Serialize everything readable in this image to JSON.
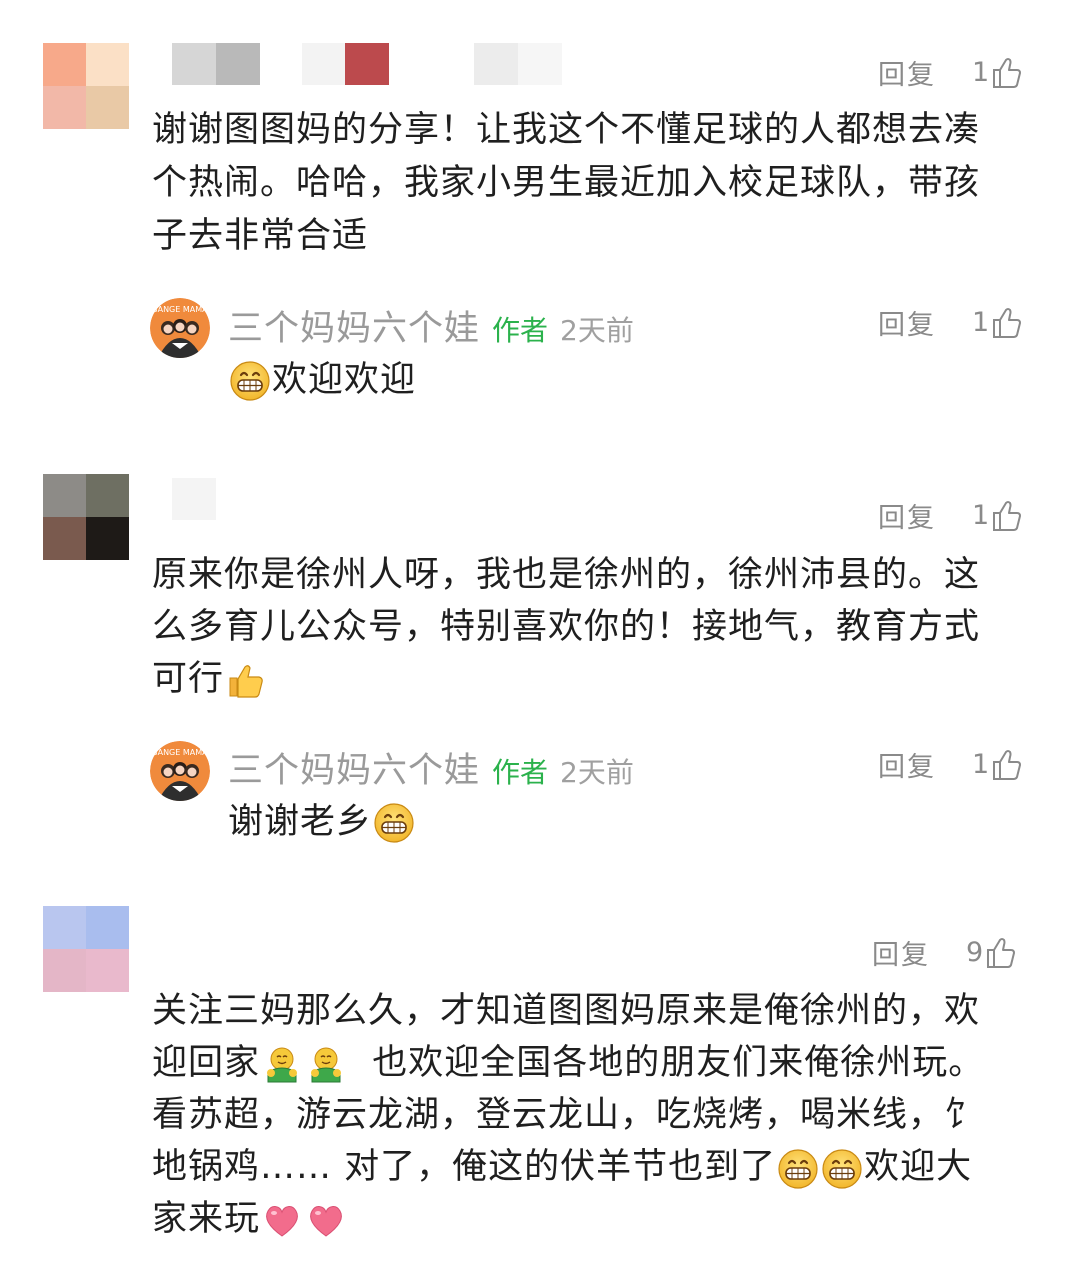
{
  "comments": [
    {
      "avatar_colors": [
        "#f7a98a",
        "#fbe0c6",
        "#f2b8a8",
        "#e9c9a6"
      ],
      "name_blur_colors": [
        "#d6d6d6",
        "#b9b9b9",
        "#bc4a4d",
        "#ececec"
      ],
      "reply_label": "回复",
      "likes": "1",
      "text_lines": [
        "谢谢图图妈的分享！让我这个不懂足球的人都想去凑",
        "个热闹。哈哈，我家小男生最近加入校足球队，带孩",
        "子去非常合适"
      ],
      "author_reply": {
        "name": "三个妈妈六个娃",
        "tag": "作者",
        "time": "2天前",
        "reply_label": "回复",
        "likes": "1",
        "text": "欢迎欢迎",
        "emoji_before": "grin-emoji"
      }
    },
    {
      "avatar_colors": [
        "#8d8b87",
        "#6e6f62",
        "#7a5a4e",
        "#1e1a17"
      ],
      "name_blur_colors": [
        "#f1f1f1"
      ],
      "reply_label": "回复",
      "likes": "1",
      "text_lines": [
        "原来你是徐州人呀，我也是徐州的，徐州沛县的。这",
        "么多育儿公众号，特别喜欢你的！接地气，教育方式",
        "可行"
      ],
      "trailing_emoji": "thumbs-up-emoji",
      "author_reply": {
        "name": "三个妈妈六个娃",
        "tag": "作者",
        "time": "2天前",
        "reply_label": "回复",
        "likes": "1",
        "text": "谢谢老乡",
        "emoji_after": "grin-emoji"
      }
    },
    {
      "avatar_colors": [
        "#b9c6ef",
        "#a9bdee",
        "#e4b6c7",
        "#e9b9cc"
      ],
      "name_blur_colors": [],
      "reply_label": "回复",
      "likes": "9",
      "text_lines": [
        {
          "parts": [
            "关注三妈那么久，才知道图图妈原来是俺徐州的，欢"
          ]
        },
        {
          "parts": [
            "迎回家",
            "  也欢迎全国各地的朋友们来俺徐州玩。"
          ]
        },
        {
          "parts": [
            "看苏超，游云龙湖，登云龙山，吃烧烤，喝米线，饣"
          ]
        },
        {
          "parts": [
            "地锅鸡…… 对了，俺这的伏羊节也到了",
            "欢迎大"
          ]
        },
        {
          "parts": [
            "家来玩"
          ]
        }
      ]
    }
  ],
  "colors": {
    "meta_gray": "#8a8a8a",
    "author_green": "#2bb24c",
    "text_dark": "#1f1f1f"
  }
}
